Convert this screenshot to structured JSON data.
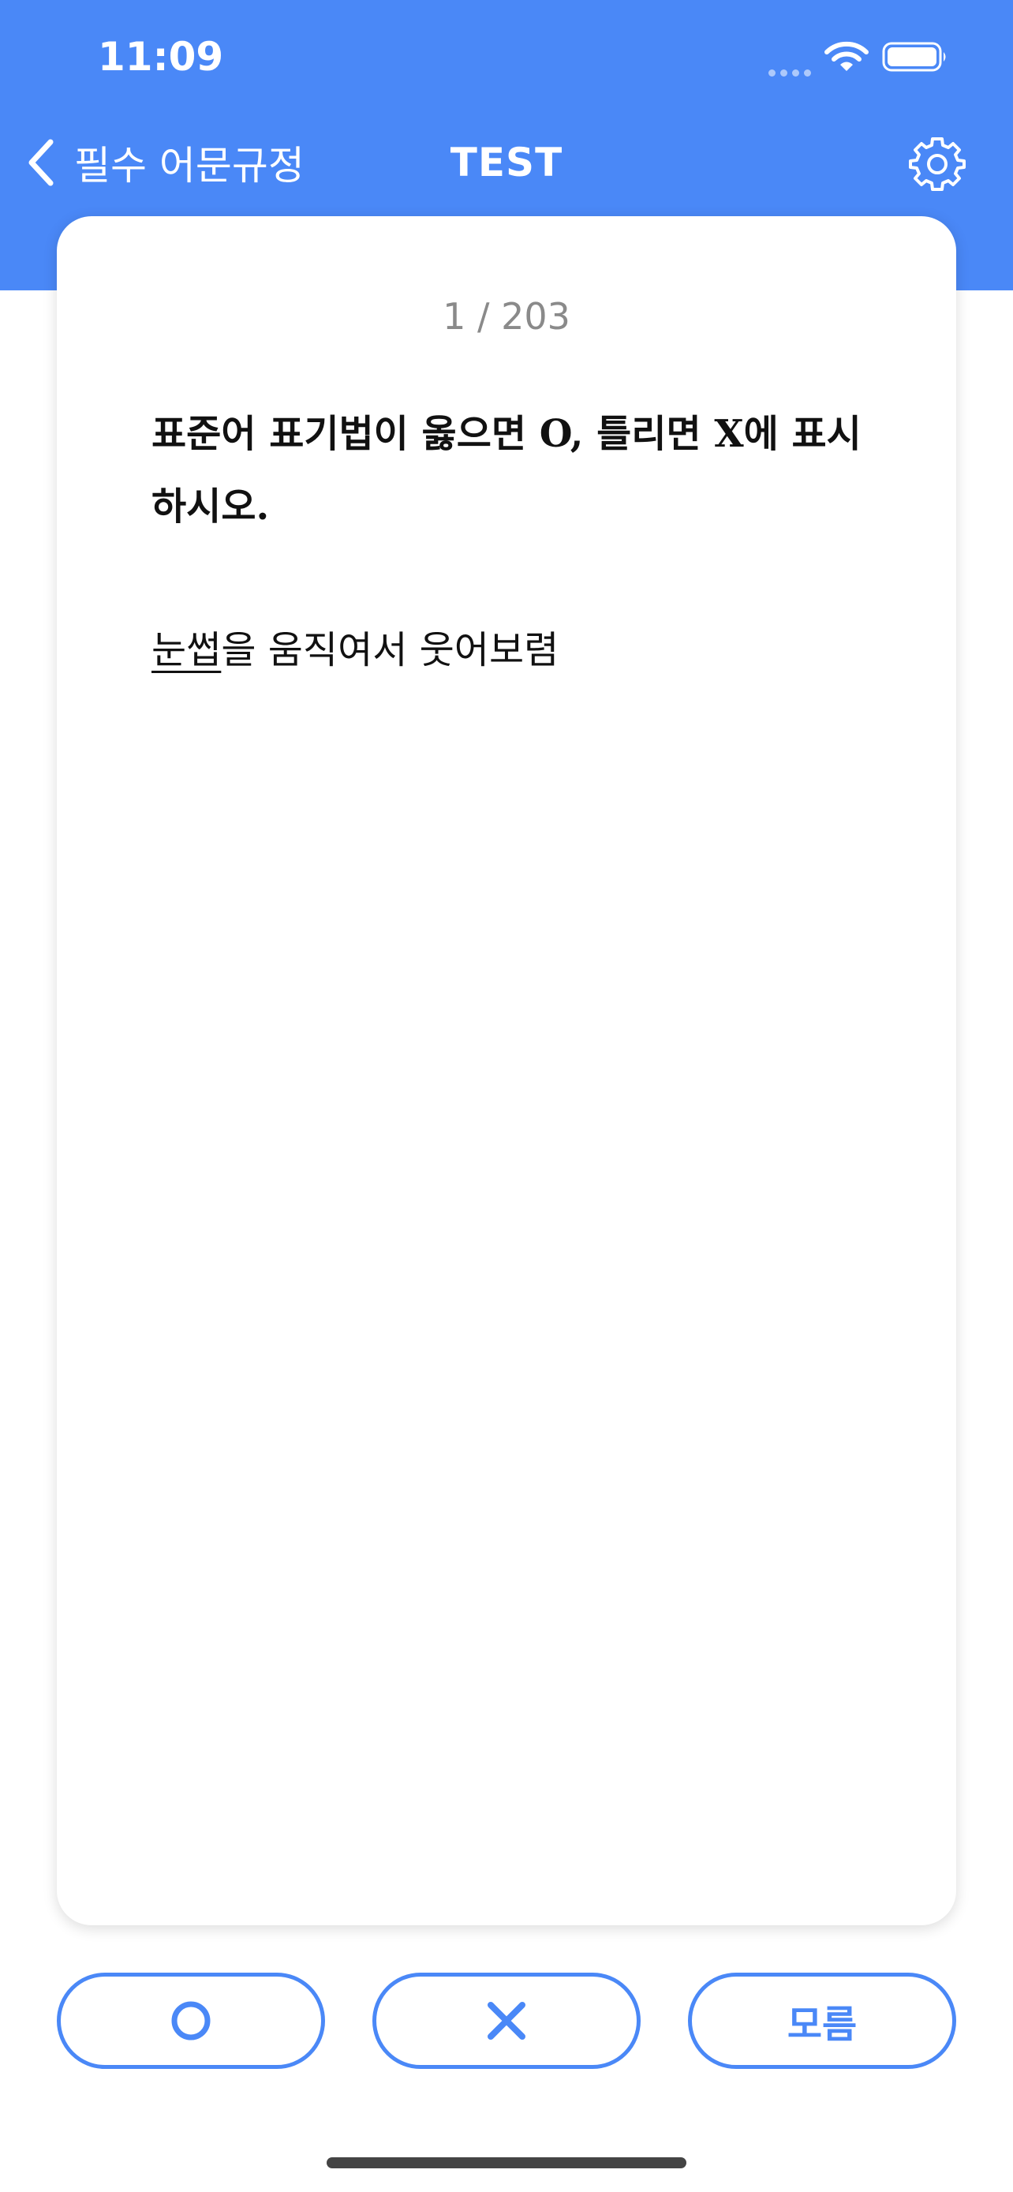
{
  "status_bar": {
    "time": "11:09",
    "icons": [
      "signal-dots-icon",
      "wifi-icon",
      "battery-icon"
    ]
  },
  "nav": {
    "back_label": "필수 어문규정",
    "title": "TEST",
    "settings_icon": "gear-icon"
  },
  "card": {
    "progress": "1 / 203",
    "question": "표준어 표기법이 옳으면 O, 틀리면 X에 표시하시오.",
    "sentence_target": "눈썹",
    "sentence_rest": "을 움직여서 웃어보렴"
  },
  "answers": {
    "o_icon": "circle-o-icon",
    "x_icon": "cross-x-icon",
    "unknown_label": "모름"
  },
  "colors": {
    "accent": "#4A88F7",
    "card_bg": "#FFFFFF",
    "text": "#111111",
    "muted_text": "#8A8A8A"
  }
}
